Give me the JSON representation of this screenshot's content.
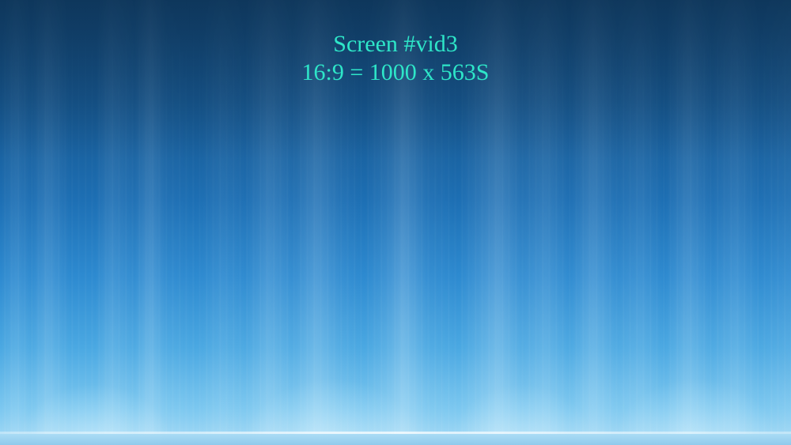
{
  "screen": {
    "title": "Screen #vid3",
    "resolution_label": "16:9 = 1000 x 563S",
    "text_color": "#2ee6c8",
    "background_color": "#1d6fb4"
  }
}
